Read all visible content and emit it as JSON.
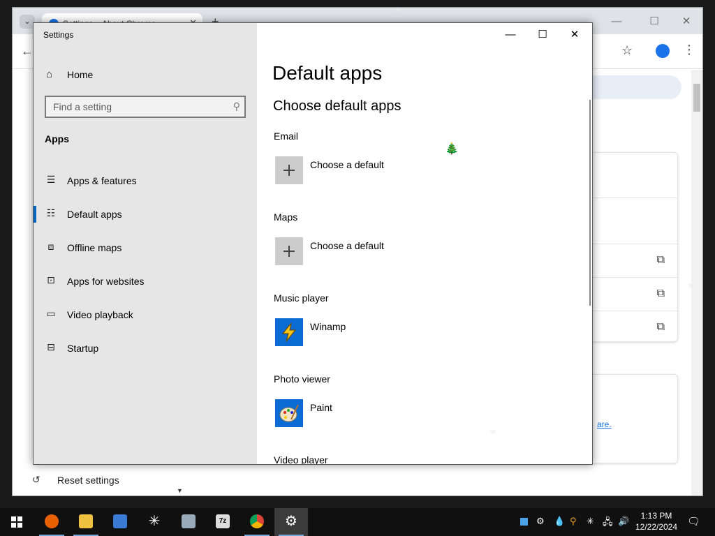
{
  "chrome": {
    "tab_title": "Settings – About Chrome",
    "new_tab": "+",
    "reset_label": "Reset settings",
    "partial_link": "are."
  },
  "settings": {
    "window_title": "Settings",
    "home_label": "Home",
    "search_placeholder": "Find a setting",
    "section": "Apps",
    "nav": [
      {
        "label": "Apps & features",
        "icon": "list-icon"
      },
      {
        "label": "Default apps",
        "icon": "default-apps-icon"
      },
      {
        "label": "Offline maps",
        "icon": "map-icon"
      },
      {
        "label": "Apps for websites",
        "icon": "web-app-icon"
      },
      {
        "label": "Video playback",
        "icon": "video-icon"
      },
      {
        "label": "Startup",
        "icon": "startup-icon"
      }
    ],
    "page_title": "Default apps",
    "subtitle": "Choose default apps",
    "categories": [
      {
        "label": "Email",
        "app": "Choose a default"
      },
      {
        "label": "Maps",
        "app": "Choose a default"
      },
      {
        "label": "Music player",
        "app": "Winamp"
      },
      {
        "label": "Photo viewer",
        "app": "Paint"
      },
      {
        "label": "Video player",
        "app": ""
      }
    ]
  },
  "taskbar": {
    "time": "1:13 PM",
    "date": "12/22/2024",
    "apps": [
      "firefox",
      "file-explorer",
      "people-app",
      "snowflake-app",
      "image-viewer",
      "7zip",
      "chrome",
      "settings"
    ]
  },
  "colors": {
    "accent": "#0067c0",
    "taskbar": "#101010",
    "settings_left": "#e6e6e6"
  }
}
